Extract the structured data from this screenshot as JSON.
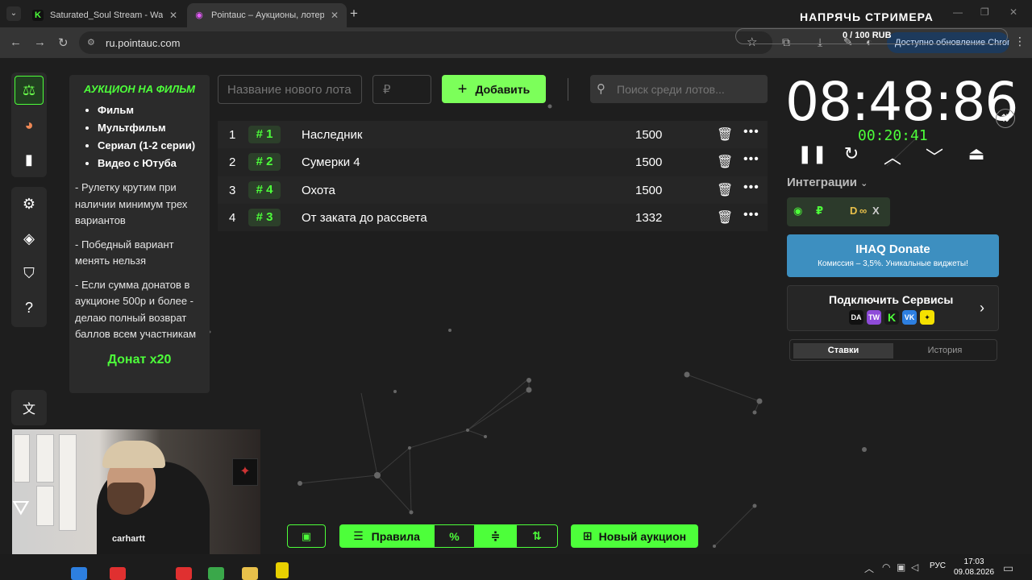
{
  "browser": {
    "tabs": [
      {
        "favicon": "K",
        "title": "Saturated_Soul Stream - Watch"
      },
      {
        "favicon": "◉",
        "title": "Pointauc – Аукционы, лотереи"
      }
    ],
    "new_tab": "+",
    "url": "ru.pointauc.com",
    "update_label": "Доступно обновление Chrome"
  },
  "stream_overlay": {
    "title": "НАПРЯЧЬ СТРИМЕРА",
    "progress": "0 / 100 RUB",
    "progress_fraction": 0
  },
  "sidebar": {
    "items": [
      {
        "icon": "gavel-icon",
        "glyph": "⚖",
        "active": true
      },
      {
        "icon": "wheel-icon",
        "glyph": "◕"
      },
      {
        "icon": "stats-icon",
        "glyph": "▮"
      },
      {
        "icon": "gear-icon",
        "glyph": "⚙"
      },
      {
        "icon": "layers-icon",
        "glyph": "◈"
      },
      {
        "icon": "shield-icon",
        "glyph": "⛉"
      },
      {
        "icon": "help-icon",
        "glyph": "?"
      },
      {
        "icon": "translate-icon",
        "glyph": "文"
      }
    ]
  },
  "info_card": {
    "title": "АУКЦИОН НА ФИЛЬМ",
    "list": [
      "Фильм",
      "Мультфильм",
      "Сериал (1-2 серии)",
      "Видео с Ютуба"
    ],
    "rules": [
      "- Рулетку крутим при наличии минимум трех вариантов",
      "- Победный вариант менять нельзя",
      "-  Если сумма донатов в аукционе 500р и более - делаю полный возврат баллов всем участникам"
    ],
    "cta": "Донат х20"
  },
  "controls": {
    "lot_name_placeholder": "Название нового лота",
    "amount_placeholder": "₽",
    "add_label": "Добавить",
    "search_placeholder": "Поиск среди лотов..."
  },
  "lots": [
    {
      "index": "1",
      "tag": "# 1",
      "title": "Наследник",
      "sum": "1500"
    },
    {
      "index": "2",
      "tag": "# 2",
      "title": "Сумерки 4",
      "sum": "1500"
    },
    {
      "index": "3",
      "tag": "# 4",
      "title": "Охота",
      "sum": "1500"
    },
    {
      "index": "4",
      "tag": "# 3",
      "title": "От заката до рассвета",
      "sum": "1332"
    }
  ],
  "timer": {
    "main": "08:48:86",
    "sub": "00:20:41"
  },
  "integrations": {
    "label": "Интеграции",
    "items": [
      "◉",
      "₽",
      "D",
      "∞",
      "X"
    ]
  },
  "donate_card": {
    "title": "IHAQ Donate",
    "subtitle": "Комиссия – 3,5%. Уникальные виджеты!"
  },
  "services": {
    "title": "Подключить Сервисы",
    "icons": [
      "DA",
      "TW",
      "K",
      "VK",
      "✦"
    ]
  },
  "history_tabs": {
    "bets": "Ставки",
    "history": "История"
  },
  "webcam": {
    "shirt_text": "carhartt"
  },
  "bottom_toolbar": {
    "rules_label": "Правила",
    "percent_label": "%",
    "new_auction_label": "Новый аукцион"
  },
  "taskbar": {
    "language": "РУС",
    "time": "17:03",
    "date": "09.08.2026"
  },
  "colors": {
    "accent_green": "#4dff3a",
    "donate_blue": "#3d8fc0",
    "background": "#1e1e1e"
  }
}
